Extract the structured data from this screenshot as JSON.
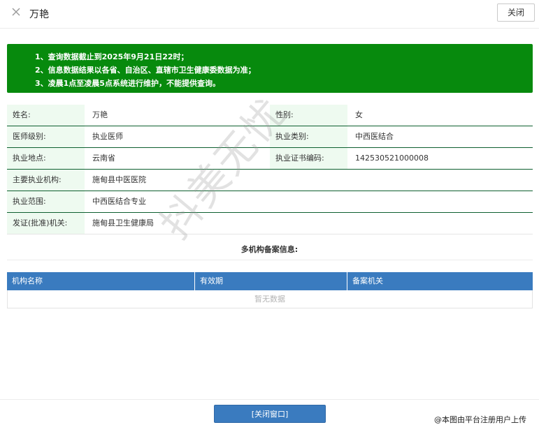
{
  "window": {
    "title": "万艳",
    "close_button": "关闭",
    "close_icon": "close-icon"
  },
  "notice": [
    "1、查询数据截止到2025年9月21日22时；",
    "2、信息数据结果以各省、自治区、直辖市卫生健康委数据为准；",
    "3、凌晨1点至凌晨5点系统进行维护，不能提供查询。"
  ],
  "info": {
    "name_label": "姓名:",
    "name": "万艳",
    "gender_label": "性别:",
    "gender": "女",
    "level_label": "医师级别:",
    "level": "执业医师",
    "category_label": "执业类别:",
    "category": "中西医结合",
    "location_label": "执业地点:",
    "location": "云南省",
    "cert_label": "执业证书编码:",
    "cert": "142530521000008",
    "institution_label": "主要执业机构:",
    "institution": "施甸县中医医院",
    "scope_label": "执业范围:",
    "scope": "中西医结合专业",
    "issuer_label": "发证(批准)机关:",
    "issuer": "施甸县卫生健康局"
  },
  "multi": {
    "title": "多机构备案信息:",
    "columns": [
      "机构名称",
      "有效期",
      "备案机关"
    ],
    "empty_text": "暂无数据"
  },
  "footer": {
    "close_window": "[关闭窗口]",
    "mark": "@本图由平台注册用户上传"
  },
  "watermark": "抖美无忧"
}
